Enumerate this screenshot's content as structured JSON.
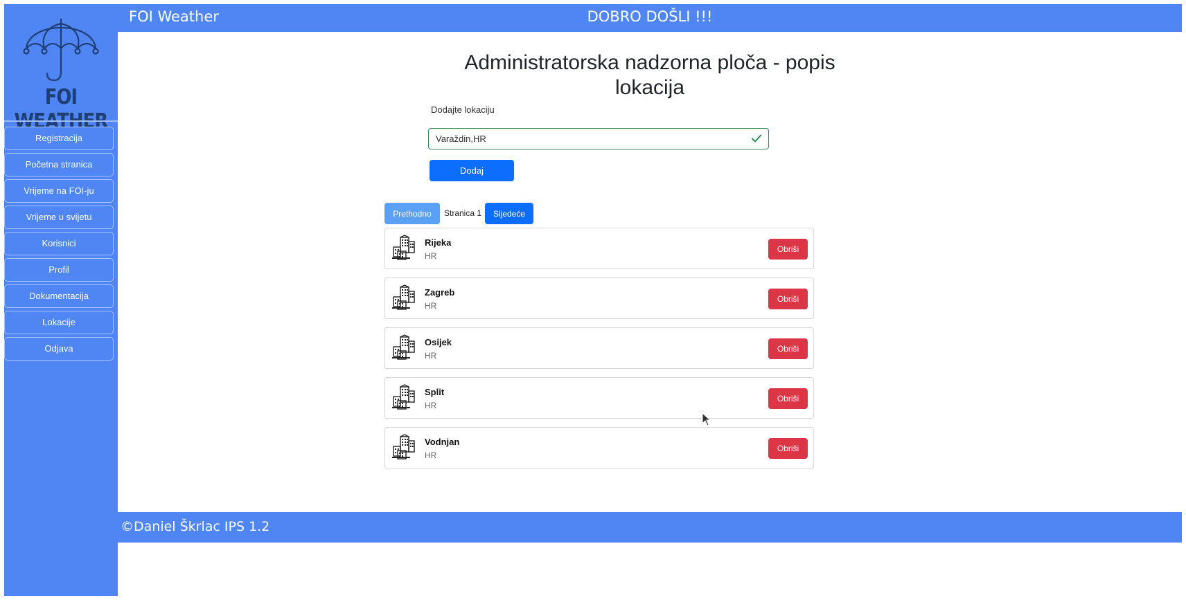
{
  "colors": {
    "brand_blue": "#4f86f4",
    "primary": "#0d6efd",
    "danger": "#dc3545",
    "success": "#2e8b57"
  },
  "sidebar": {
    "logo_text": "FOI WEATHER",
    "items": [
      {
        "label": "Registracija"
      },
      {
        "label": "Početna stranica"
      },
      {
        "label": "Vrijeme na FOI-ju"
      },
      {
        "label": "Vrijeme u svijetu"
      },
      {
        "label": "Korisnici"
      },
      {
        "label": "Profil"
      },
      {
        "label": "Dokumentacija"
      },
      {
        "label": "Lokacije"
      },
      {
        "label": "Odjava"
      }
    ]
  },
  "header": {
    "brand": "FOI Weather",
    "welcome": "DOBRO DOŠLI !!!"
  },
  "main": {
    "title_line1": "Administratorska nadzorna ploča - popis",
    "title_line2": "lokacija",
    "add_label": "Dodajte lokaciju",
    "location_input_value": "Varaždin,HR",
    "add_button": "Dodaj",
    "pagination": {
      "prev": "Prethodno",
      "page_label": "Stranica 1",
      "next": "Sljedeće"
    },
    "locations": [
      {
        "name": "Rijeka",
        "country": "HR",
        "action": "Obriši",
        "icon": "city-buildings-icon"
      },
      {
        "name": "Zagreb",
        "country": "HR",
        "action": "Obriši",
        "icon": "city-buildings-icon"
      },
      {
        "name": "Osijek",
        "country": "HR",
        "action": "Obriši",
        "icon": "city-buildings-icon"
      },
      {
        "name": "Split",
        "country": "HR",
        "action": "Obriši",
        "icon": "city-buildings-icon"
      },
      {
        "name": "Vodnjan",
        "country": "HR",
        "action": "Obriši",
        "icon": "city-buildings-icon"
      }
    ]
  },
  "footer": {
    "copyright": "©Daniel Škrlac IPS 1.2"
  }
}
